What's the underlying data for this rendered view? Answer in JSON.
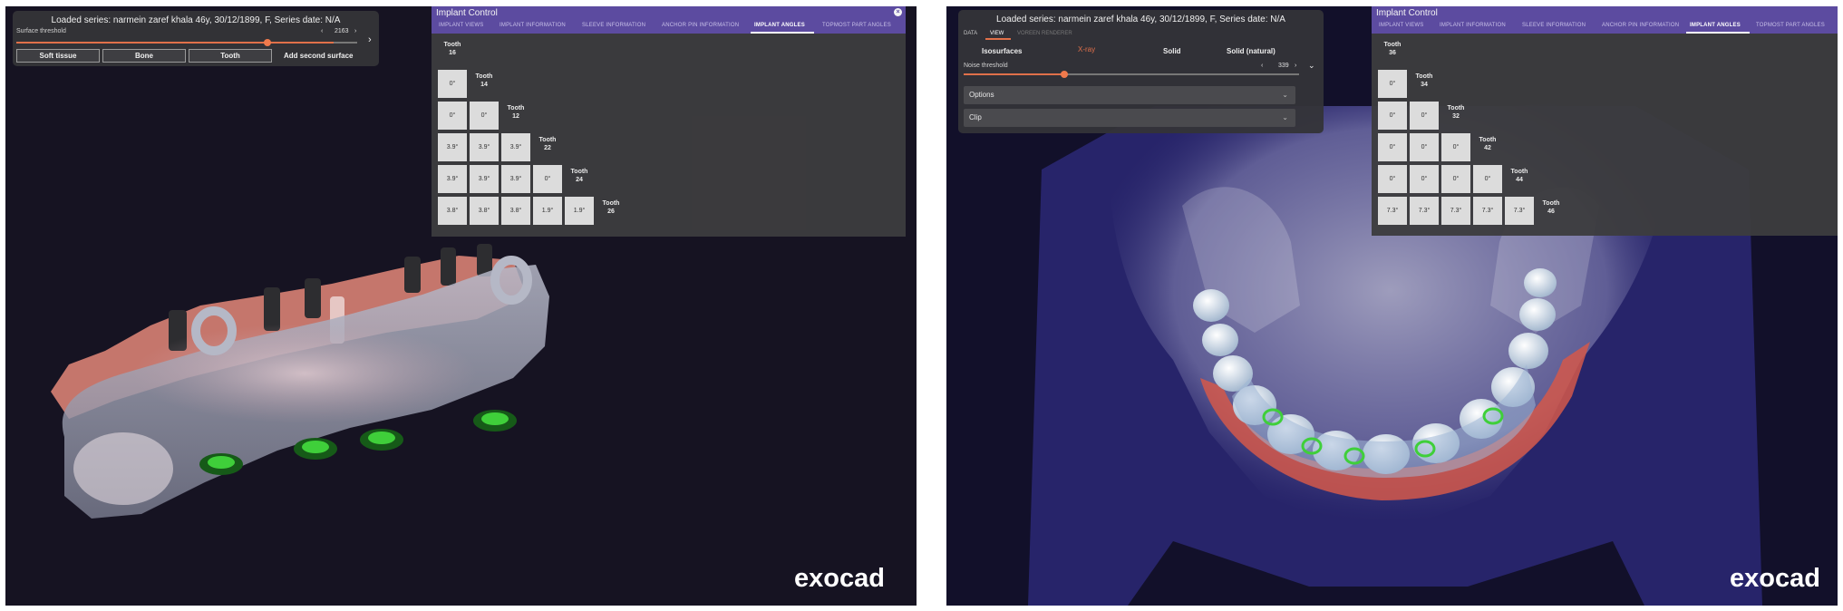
{
  "left": {
    "series_title": "Loaded series: narmein zaref khala 46y, 30/12/1899, F, Series date: N/A",
    "surface_threshold_label": "Surface threshold",
    "surface_threshold_value": "2163",
    "slider_position": 0.93,
    "buttons": {
      "soft_tissue": "Soft tissue",
      "bone": "Bone",
      "tooth": "Tooth",
      "add_second_surface": "Add second surface"
    },
    "implant_control": {
      "title": "Implant Control",
      "tabs": [
        "IMPLANT VIEWS",
        "IMPLANT INFORMATION",
        "SLEEVE INFORMATION",
        "ANCHOR PIN INFORMATION",
        "IMPLANT ANGLES",
        "TOPMOST PART ANGLES"
      ],
      "active_tab": "IMPLANT ANGLES",
      "teeth": [
        "Tooth\n16",
        "Tooth\n14",
        "Tooth\n12",
        "Tooth\n22",
        "Tooth\n24",
        "Tooth\n26"
      ],
      "rows": [
        [
          "0°"
        ],
        [
          "0°",
          "0°"
        ],
        [
          "3.9°",
          "3.9°",
          "3.9°"
        ],
        [
          "3.9°",
          "3.9°",
          "3.9°",
          "0°"
        ],
        [
          "3.8°",
          "3.8°",
          "3.8°",
          "1.9°",
          "1.9°"
        ]
      ]
    },
    "brand": "exocad"
  },
  "right": {
    "series_title": "Loaded series: narmein zaref khala 46y, 30/12/1899, F, Series date: N/A",
    "sub_tabs": [
      "DATA",
      "VIEW",
      "VOREEN RENDERER"
    ],
    "active_sub_tab": "VIEW",
    "render_modes": {
      "isosurfaces": "Isosurfaces",
      "xray": "X-ray",
      "solid": "Solid",
      "solid_natural": "Solid (natural)"
    },
    "noise_threshold_label": "Noise threshold",
    "noise_threshold_value": "339",
    "slider_position": 0.3,
    "options_label": "Options",
    "clip_label": "Clip",
    "implant_control": {
      "title": "Implant Control",
      "tabs": [
        "IMPLANT VIEWS",
        "IMPLANT INFORMATION",
        "SLEEVE INFORMATION",
        "ANCHOR PIN INFORMATION",
        "IMPLANT ANGLES",
        "TOPMOST PART ANGLES"
      ],
      "active_tab": "IMPLANT ANGLES",
      "teeth": [
        "Tooth\n36",
        "Tooth\n34",
        "Tooth\n32",
        "Tooth\n42",
        "Tooth\n44",
        "Tooth\n46"
      ],
      "rows": [
        [
          "0°"
        ],
        [
          "0°",
          "0°"
        ],
        [
          "0°",
          "0°",
          "0°"
        ],
        [
          "0°",
          "0°",
          "0°",
          "0°"
        ],
        [
          "7.3°",
          "7.3°",
          "7.3°",
          "7.3°",
          "7.3°"
        ]
      ]
    },
    "brand": "exocad"
  },
  "colors": {
    "accent": "#e0704a",
    "implant_header": "#5c4ba0",
    "implant_green": "#3fcf3a"
  }
}
